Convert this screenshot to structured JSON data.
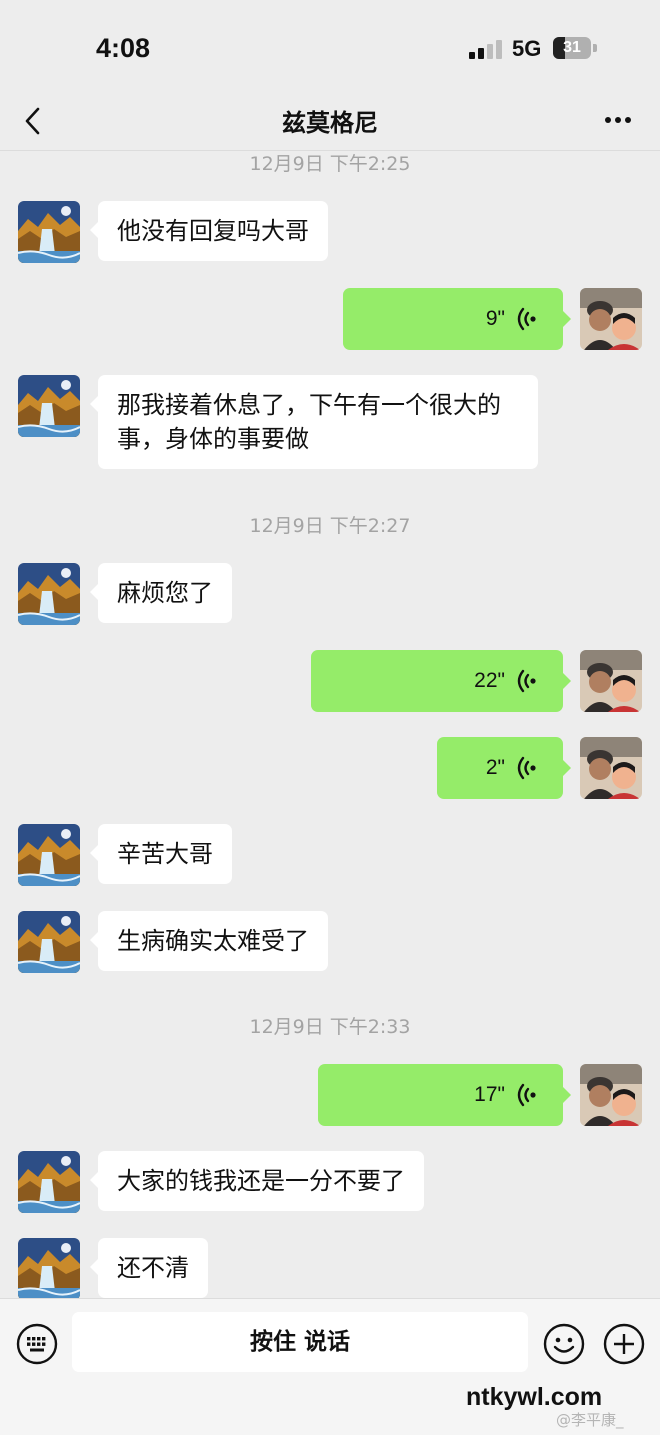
{
  "status_bar": {
    "time": "4:08",
    "network": "5G",
    "battery": "31",
    "battery_level": 0.31
  },
  "nav": {
    "title": "兹莫格尼",
    "back_icon": "chevron-left-icon",
    "more_icon": "more-dots-icon"
  },
  "timestamps": [
    "12月9日 下午2:25",
    "12月9日 下午2:27",
    "12月9日 下午2:33"
  ],
  "messages": [
    {
      "side": "in",
      "type": "text",
      "text": "他没有回复吗大哥"
    },
    {
      "side": "out",
      "type": "voice",
      "duration": "9\""
    },
    {
      "side": "in",
      "type": "text",
      "text": "那我接着休息了，下午有一个很大的事，身体的事要做"
    },
    {
      "side": "in",
      "type": "text",
      "text": "麻烦您了"
    },
    {
      "side": "out",
      "type": "voice",
      "duration": "22\""
    },
    {
      "side": "out",
      "type": "voice",
      "duration": "2\""
    },
    {
      "side": "in",
      "type": "text",
      "text": "辛苦大哥"
    },
    {
      "side": "in",
      "type": "text",
      "text": "生病确实太难受了"
    },
    {
      "side": "out",
      "type": "voice",
      "duration": "17\""
    },
    {
      "side": "in",
      "type": "text",
      "text": "大家的钱我还是一分不要了"
    },
    {
      "side": "in",
      "type": "text",
      "text": "还不清"
    }
  ],
  "input_bar": {
    "keyboard_icon": "keyboard-icon",
    "hold_to_talk": "按住 说话",
    "emoji_icon": "emoji-icon",
    "plus_icon": "plus-icon"
  },
  "watermark": {
    "site": "ntkywl.com",
    "credit": "@李平康_"
  },
  "colors": {
    "background": "#ededed",
    "incoming_bubble": "#ffffff",
    "outgoing_bubble": "#95ec69",
    "timestamp": "#a3a3a3"
  }
}
